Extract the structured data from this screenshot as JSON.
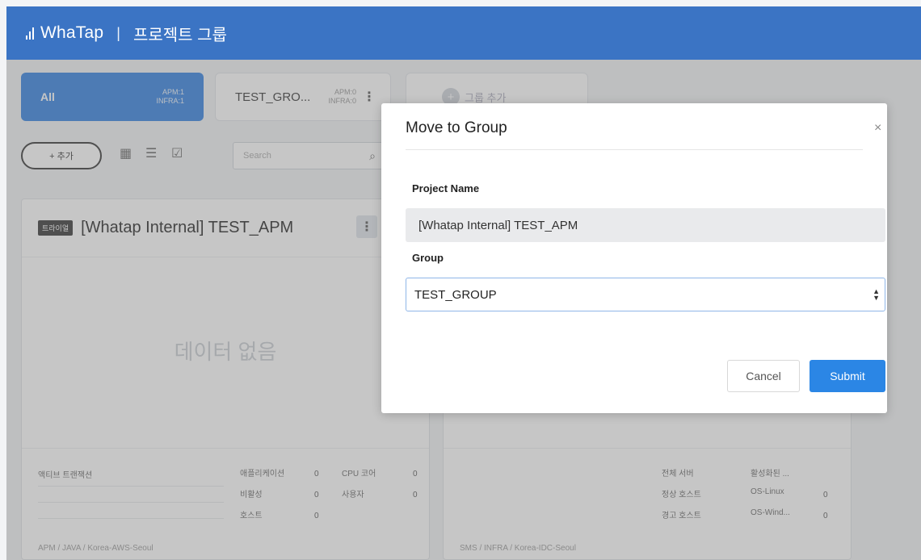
{
  "header": {
    "brand": "WhaTap",
    "separator": "|",
    "page_title": "프로젝트 그룹"
  },
  "group_tabs": [
    {
      "label": "All",
      "count_apm": "APM:1",
      "count_infra": "INFRA:1"
    },
    {
      "label": "TEST_GRO...",
      "count_apm": "APM:0",
      "count_infra": "INFRA:0"
    },
    {
      "label": "그룹 추가"
    }
  ],
  "toolbar": {
    "add_label": "+ 추가",
    "search_placeholder": "Search"
  },
  "cards": [
    {
      "badge": "트라이얼",
      "title": "[Whatap Internal] TEST_APM",
      "empty_text": "데이터 없음",
      "stat_header": "액티브 트랜잭션",
      "stats": [
        {
          "label": "애플리케이션",
          "value": "0"
        },
        {
          "label": "CPU 코어",
          "value": "0"
        },
        {
          "label": "비활성",
          "value": "0"
        },
        {
          "label": "사용자",
          "value": "0"
        },
        {
          "label": "호스트",
          "value": "0"
        }
      ],
      "path": "APM / JAVA / Korea-AWS-Seoul"
    },
    {
      "stats": [
        {
          "label": "전체 서버",
          "value": ""
        },
        {
          "label": "활성화된 ...",
          "value": ""
        },
        {
          "label": "정상 호스트",
          "value": ""
        },
        {
          "label": "OS-Linux",
          "value": "0"
        },
        {
          "label": "경고 호스트",
          "value": ""
        },
        {
          "label": "OS-Wind...",
          "value": "0"
        }
      ],
      "path": "SMS / INFRA / Korea-IDC-Seoul"
    }
  ],
  "modal": {
    "title": "Move to Group",
    "close_glyph": "×",
    "project_name_label": "Project Name",
    "project_name_value": "[Whatap Internal] TEST_APM",
    "group_label": "Group",
    "group_value": "TEST_GROUP",
    "cancel_label": "Cancel",
    "submit_label": "Submit"
  },
  "colors": {
    "header": "#3b74c4",
    "primary": "#2b86e5"
  },
  "icons": [
    "whatap-logo-icon",
    "kebab-icon",
    "add-icon",
    "grid-view-icon",
    "list-view-icon",
    "checklist-view-icon",
    "search-icon",
    "close-icon",
    "select-arrows-icon"
  ]
}
